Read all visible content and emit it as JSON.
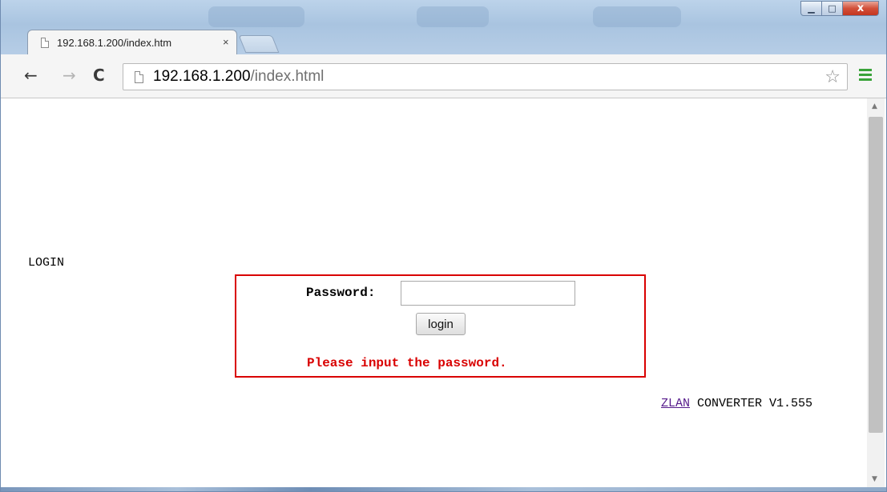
{
  "browser": {
    "tab_title": "192.168.1.200/index.htm",
    "tab_close": "×",
    "url_host": "192.168.1.200",
    "url_path": "/index.html",
    "nav": {
      "back": "←",
      "forward": "→",
      "reload": "C"
    },
    "star_icon": "☆",
    "window_controls": {
      "minimize": "▁",
      "maximize": "□",
      "close": "x"
    },
    "scroll": {
      "up": "▲",
      "down": "▼"
    }
  },
  "page": {
    "heading": "LOGIN",
    "password_label": "Password:",
    "password_value": "",
    "login_button": "login",
    "error_message": "Please input the password.",
    "footer_link": "ZLAN",
    "footer_text": " CONVERTER V1.555"
  },
  "colors": {
    "error_red": "#d90000",
    "link_visited": "#551a8b",
    "menu_green": "#3aa33a"
  }
}
